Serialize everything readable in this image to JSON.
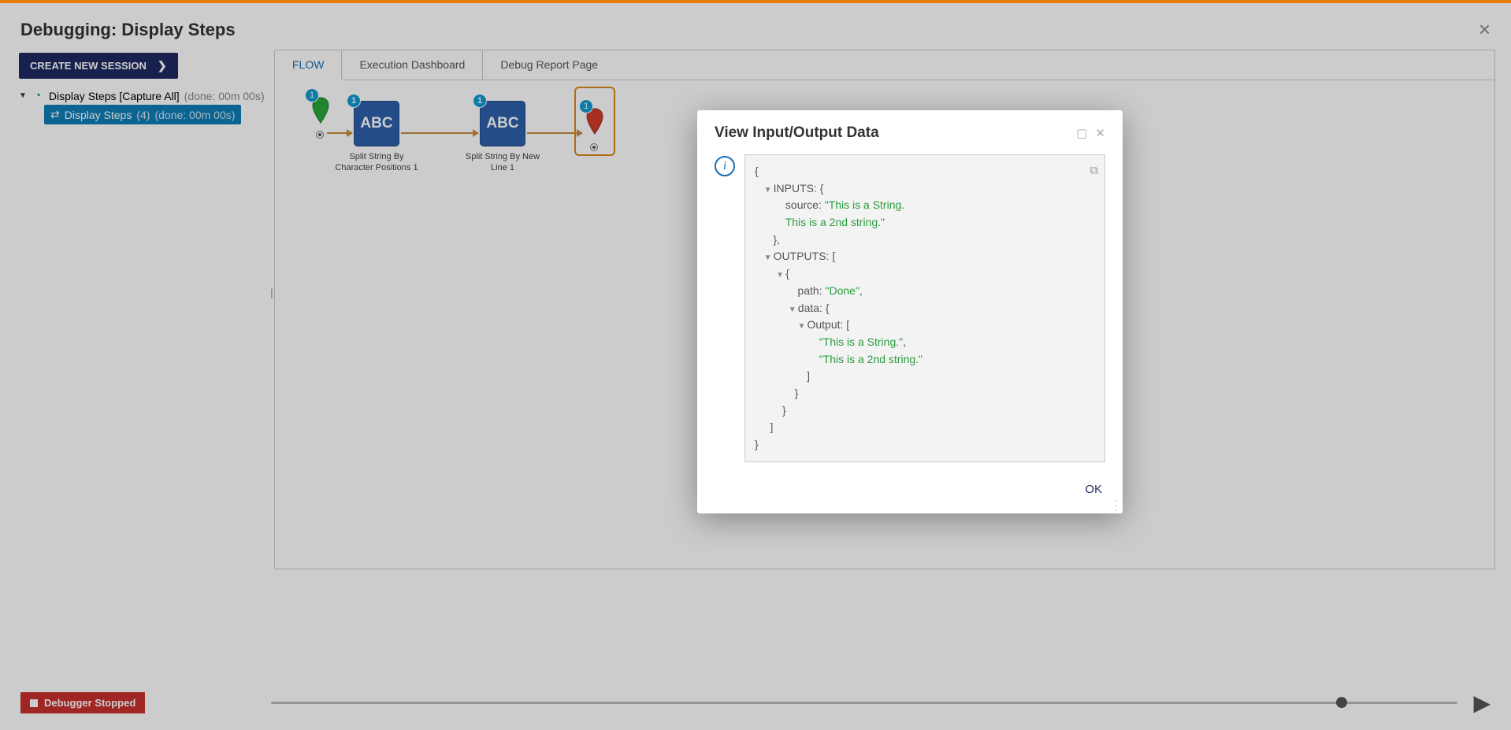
{
  "header": {
    "title": "Debugging: Display Steps"
  },
  "sidebar": {
    "new_session_label": "CREATE NEW SESSION",
    "root": {
      "label": "Display Steps [Capture All]",
      "status": "(done: 00m 00s)"
    },
    "child": {
      "label": "Display Steps",
      "count": "(4)",
      "status": "(done: 00m 00s)"
    }
  },
  "tabs": {
    "flow": "FLOW",
    "dashboard": "Execution Dashboard",
    "report": "Debug Report Page"
  },
  "nodes": {
    "start_badge": "1",
    "n1": {
      "badge": "1",
      "block": "ABC",
      "label": "Split String By Character Positions 1"
    },
    "n2": {
      "badge": "1",
      "block": "ABC",
      "label": "Split String By New Line 1"
    },
    "end_badge": "1"
  },
  "debugger_status": "Debugger Stopped",
  "dialog": {
    "title": "View Input/Output Data",
    "ok_label": "OK",
    "json": {
      "inputs_label": "INPUTS: {",
      "source_key": "source:",
      "source_line1": "\"This is a String.",
      "source_line2": "This is a 2nd string.\"",
      "inputs_close": "},",
      "outputs_label": "OUTPUTS: [",
      "brace_open": "{",
      "path_key": "path:",
      "path_val": "\"Done\"",
      "data_key": "data: {",
      "output_key": "Output: [",
      "out_val1": "\"This is a String.\"",
      "out_val2": "\"This is a 2nd string.\"",
      "close_sq": "]",
      "close_br": "}",
      "root_close": "}"
    }
  }
}
